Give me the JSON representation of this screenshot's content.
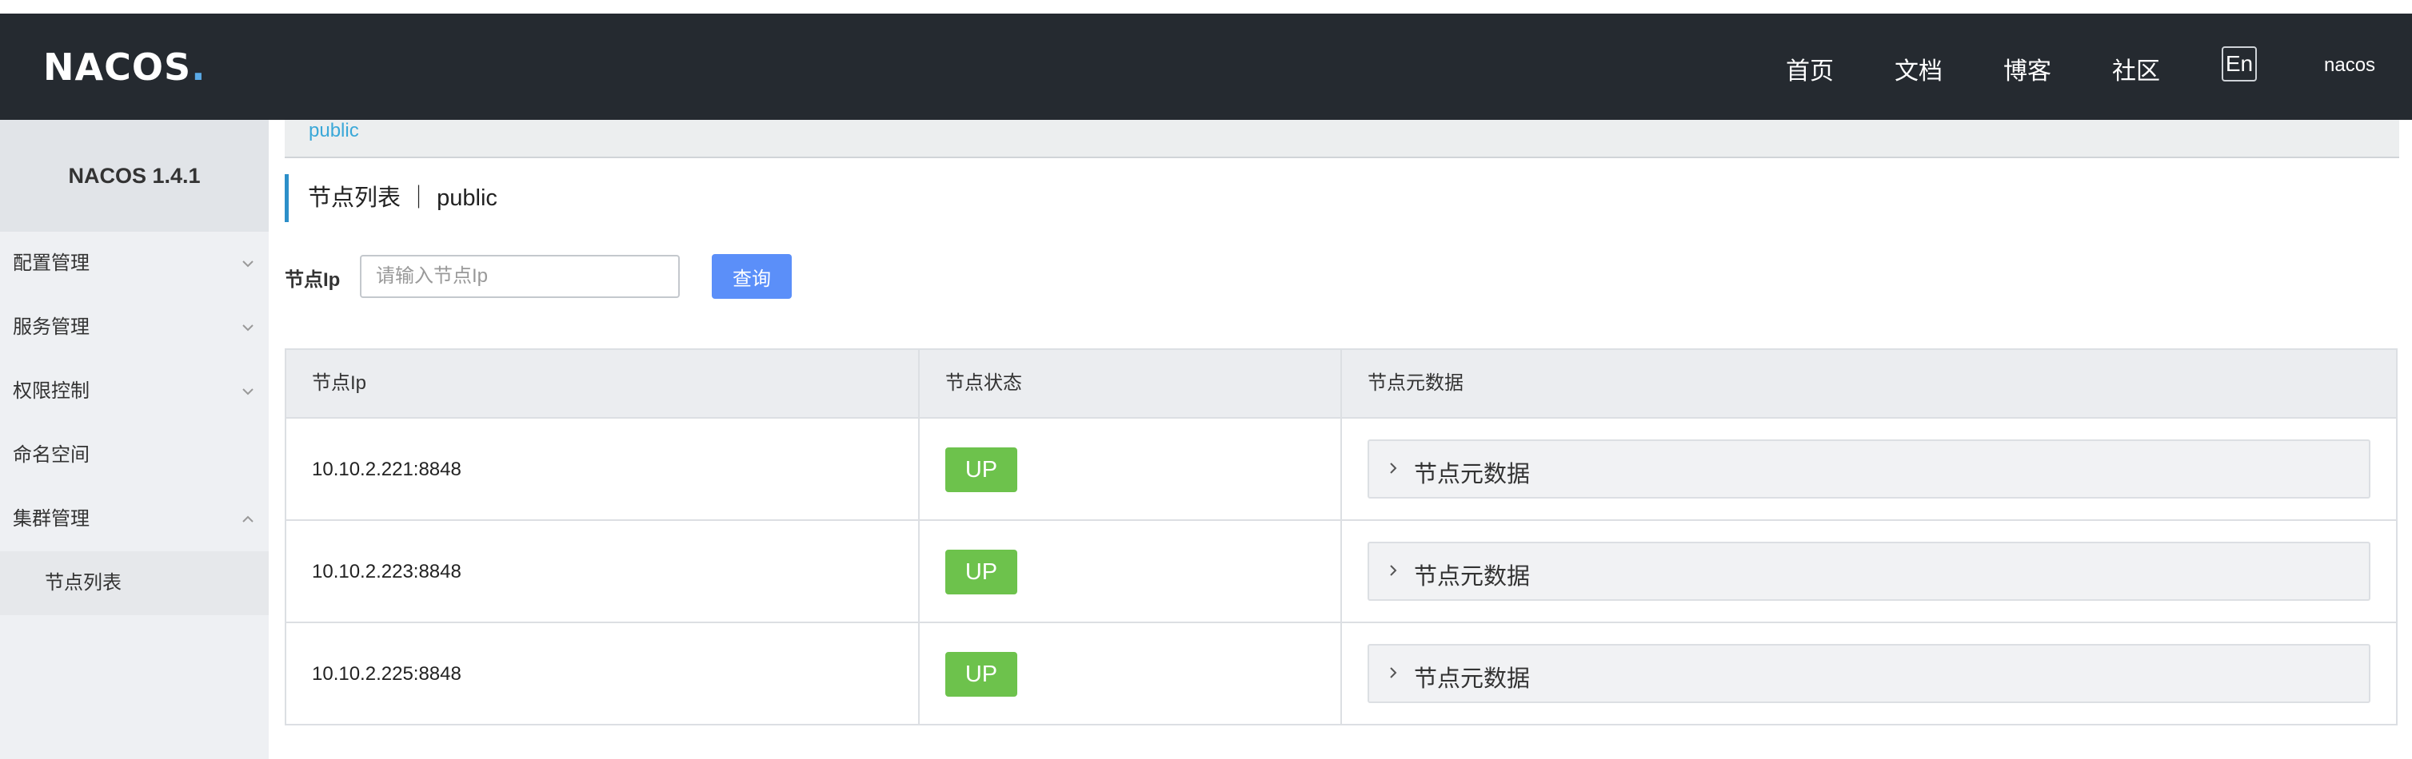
{
  "header": {
    "logo": "NACOS.",
    "nav": [
      "首页",
      "文档",
      "博客",
      "社区"
    ],
    "lang": "En",
    "user": "nacos"
  },
  "sidebar": {
    "version": "NACOS 1.4.1",
    "items": [
      {
        "label": "配置管理",
        "icon": "chevron-down-icon"
      },
      {
        "label": "服务管理",
        "icon": "chevron-down-icon"
      },
      {
        "label": "权限控制",
        "icon": "chevron-down-icon"
      },
      {
        "label": "命名空间",
        "icon": ""
      },
      {
        "label": "集群管理",
        "icon": "chevron-up-icon"
      }
    ],
    "subitems": [
      {
        "label": "节点列表"
      }
    ]
  },
  "main": {
    "breadcrumb": "public",
    "title": "节点列表 ｜ public",
    "filter_label": "节点Ip",
    "search_placeholder": "请输入节点Ip",
    "query_button": "查询",
    "table": {
      "headers": [
        "节点Ip",
        "节点状态",
        "节点元数据"
      ],
      "rows": [
        {
          "ip": "10.10.2.221:8848",
          "status": "UP",
          "meta": "节点元数据"
        },
        {
          "ip": "10.10.2.223:8848",
          "status": "UP",
          "meta": "节点元数据"
        },
        {
          "ip": "10.10.2.225:8848",
          "status": "UP",
          "meta": "节点元数据"
        }
      ]
    }
  },
  "colors": {
    "header_bg": "#252a30",
    "accent_blue": "#5b8ff9",
    "status_up": "#6dc24c",
    "link": "#3aa8d8"
  }
}
